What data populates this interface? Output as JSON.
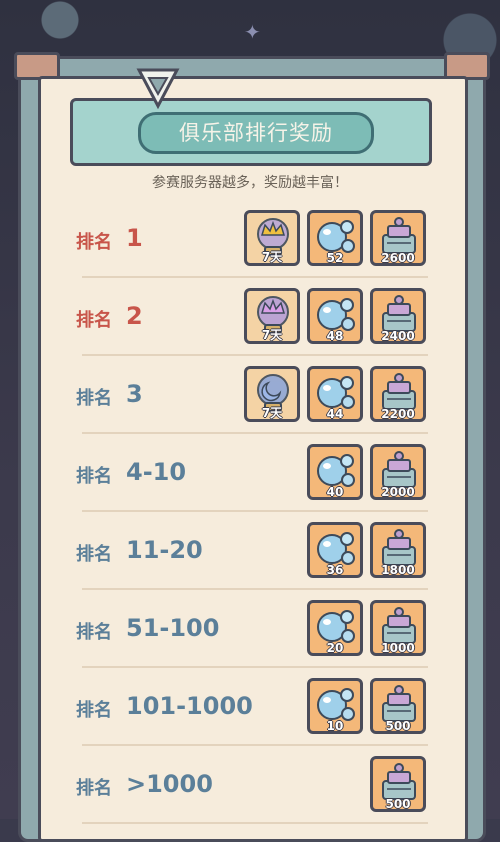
{
  "header": {
    "title": "俱乐部排行奖励",
    "subtitle": "参赛服务器越多，奖励越丰富！"
  },
  "rank_label": "排名",
  "rows": [
    {
      "rank": "1",
      "tier": "gold",
      "rewards": [
        {
          "type": "trophy-crown-gold",
          "qty": "7天"
        },
        {
          "type": "orb-bubbles",
          "qty": "52"
        },
        {
          "type": "treasure-pile",
          "qty": "2600"
        }
      ]
    },
    {
      "rank": "2",
      "tier": "gold",
      "rewards": [
        {
          "type": "trophy-crown-purple",
          "qty": "7天"
        },
        {
          "type": "orb-bubbles",
          "qty": "48"
        },
        {
          "type": "treasure-pile",
          "qty": "2400"
        }
      ]
    },
    {
      "rank": "3",
      "tier": "blue",
      "rewards": [
        {
          "type": "trophy-moon-blue",
          "qty": "7天"
        },
        {
          "type": "orb-bubbles",
          "qty": "44"
        },
        {
          "type": "treasure-pile",
          "qty": "2200"
        }
      ]
    },
    {
      "rank": "4-10",
      "tier": "blue",
      "rewards": [
        {
          "type": "orb-bubbles",
          "qty": "40"
        },
        {
          "type": "treasure-pile",
          "qty": "2000"
        }
      ]
    },
    {
      "rank": "11-20",
      "tier": "blue",
      "rewards": [
        {
          "type": "orb-bubbles",
          "qty": "36"
        },
        {
          "type": "treasure-pile",
          "qty": "1800"
        }
      ]
    },
    {
      "rank": "51-100",
      "tier": "blue",
      "rewards": [
        {
          "type": "orb-bubbles",
          "qty": "20"
        },
        {
          "type": "treasure-pile",
          "qty": "1000"
        }
      ]
    },
    {
      "rank": "101-1000",
      "tier": "blue",
      "rewards": [
        {
          "type": "orb-bubbles",
          "qty": "10"
        },
        {
          "type": "treasure-pile",
          "qty": "500"
        }
      ]
    },
    {
      "rank": ">1000",
      "tier": "blue",
      "rewards": [
        {
          "type": "treasure-pile",
          "qty": "500"
        }
      ]
    }
  ],
  "colors": {
    "gold_rank": "#c8554a",
    "blue_rank": "#5b7f99",
    "panel": "#f6ecdc",
    "title_bar": "#a4d3cd"
  }
}
